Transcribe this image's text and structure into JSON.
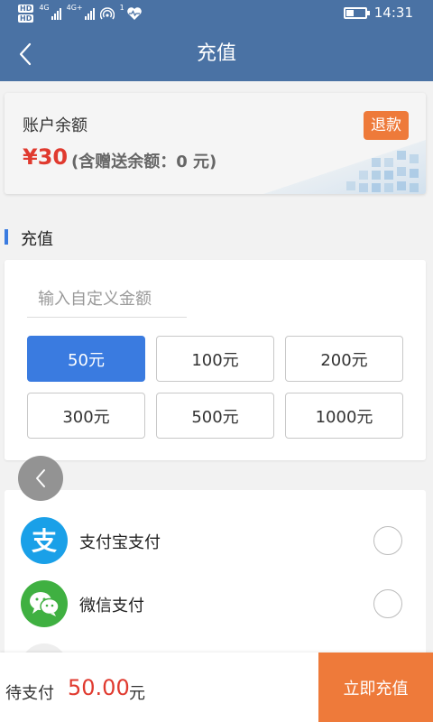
{
  "status_bar": {
    "hd_labels": [
      "HD",
      "HD"
    ],
    "network_labels": [
      "4G",
      "4G+"
    ],
    "wifi_badge": "1",
    "time": "14:31"
  },
  "nav": {
    "title": "充值"
  },
  "balance": {
    "label": "账户余额",
    "amount": "¥30",
    "gift_note": "(含赠送余额：0 元)",
    "refund_label": "退款"
  },
  "recharge": {
    "section_title": "充值",
    "input_placeholder": "输入自定义金额",
    "input_value": "",
    "options": [
      {
        "label": "50元",
        "selected": true
      },
      {
        "label": "100元",
        "selected": false
      },
      {
        "label": "200元",
        "selected": false
      },
      {
        "label": "300元",
        "selected": false
      },
      {
        "label": "500元",
        "selected": false
      },
      {
        "label": "1000元",
        "selected": false
      }
    ]
  },
  "payment": {
    "methods": [
      {
        "label": "支付宝支付",
        "icon": "alipay-icon",
        "color": "#1aa0e8",
        "selected": false
      },
      {
        "label": "微信支付",
        "icon": "wechat-icon",
        "color": "#3fb041",
        "selected": false
      }
    ]
  },
  "footer": {
    "pending_label": "待支付",
    "pending_amount": "50.00",
    "pending_unit": "元",
    "submit_label": "立即充值"
  },
  "colors": {
    "header": "#4a72a4",
    "accent_blue": "#3a7be0",
    "accent_orange": "#ee7a3a",
    "price_red": "#e03a2f"
  }
}
